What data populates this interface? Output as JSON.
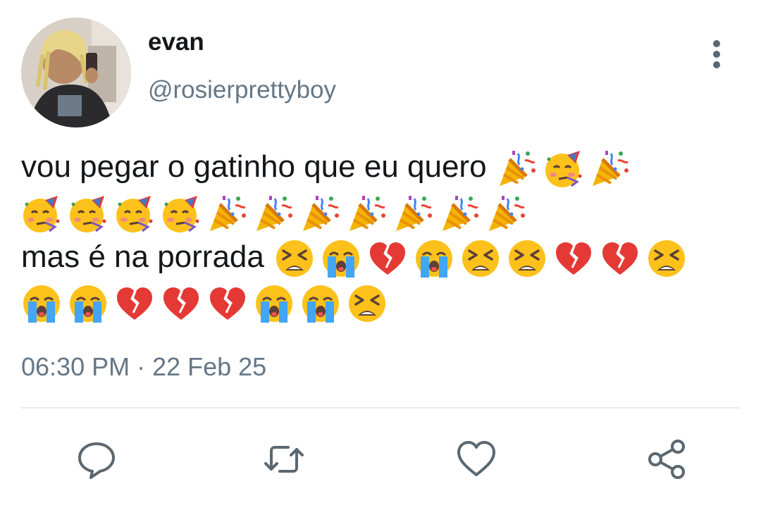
{
  "author": {
    "display_name": "evan",
    "handle": "@rosierprettyboy",
    "avatar_icon": "profile-photo-avatar"
  },
  "menu": {
    "icon": "more-vertical-icon"
  },
  "tweet": {
    "lines": [
      {
        "text": "vou pegar o gatinho que eu quero",
        "emojis": [
          "party-popper",
          "partying-face",
          "party-popper"
        ]
      },
      {
        "text": "",
        "emojis": [
          "partying-face",
          "partying-face",
          "partying-face",
          "partying-face",
          "party-popper",
          "party-popper",
          "party-popper",
          "party-popper",
          "party-popper",
          "party-popper",
          "party-popper"
        ]
      },
      {
        "text": "mas é na porrada",
        "emojis": [
          "tired-face",
          "loudly-crying-face",
          "broken-heart",
          "loudly-crying-face",
          "tired-face",
          "tired-face",
          "broken-heart",
          "broken-heart",
          "tired-face"
        ]
      },
      {
        "text": "",
        "emojis": [
          "loudly-crying-face",
          "loudly-crying-face",
          "broken-heart",
          "broken-heart",
          "broken-heart",
          "loudly-crying-face",
          "loudly-crying-face",
          "tired-face"
        ]
      }
    ]
  },
  "timestamp": "06:30 PM · 22 Feb 25",
  "actions": [
    {
      "name": "reply-button",
      "icon": "comment-bubble-icon"
    },
    {
      "name": "retweet-button",
      "icon": "retweet-icon"
    },
    {
      "name": "like-button",
      "icon": "heart-icon"
    },
    {
      "name": "share-button",
      "icon": "share-icon"
    }
  ],
  "colors": {
    "text_primary": "#14171a",
    "text_secondary": "#657786",
    "divider": "#e6ecf0",
    "icon": "#5b6770"
  }
}
